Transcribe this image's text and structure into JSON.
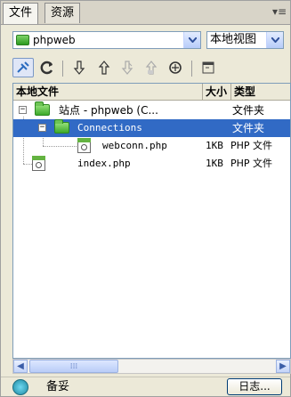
{
  "tabs": [
    {
      "label": "文件"
    },
    {
      "label": "资源"
    }
  ],
  "panel_menu_icon": "panel-options-icon",
  "site_select": {
    "value": "phpweb"
  },
  "view_select": {
    "value": "本地视图"
  },
  "toolbar_icons": [
    "connect-icon",
    "refresh-icon",
    "get-icon",
    "put-icon",
    "checkout-icon",
    "checkin-icon",
    "sync-icon",
    "expand-icon"
  ],
  "columns": {
    "name": "本地文件",
    "size": "大小",
    "type": "类型"
  },
  "rows": [
    {
      "name": "站点 - phpweb (C...",
      "size": "",
      "type": "文件夹"
    },
    {
      "name": "Connections",
      "size": "",
      "type": "文件夹"
    },
    {
      "name": "webconn.php",
      "size": "1KB",
      "type": "PHP 文件"
    },
    {
      "name": "index.php",
      "size": "1KB",
      "type": "PHP 文件"
    }
  ],
  "status": {
    "text": "备妥",
    "log_label": "日志..."
  },
  "colors": {
    "selection": "#316ac5",
    "folder": "#3daa2a",
    "panel": "#ece9d8"
  }
}
